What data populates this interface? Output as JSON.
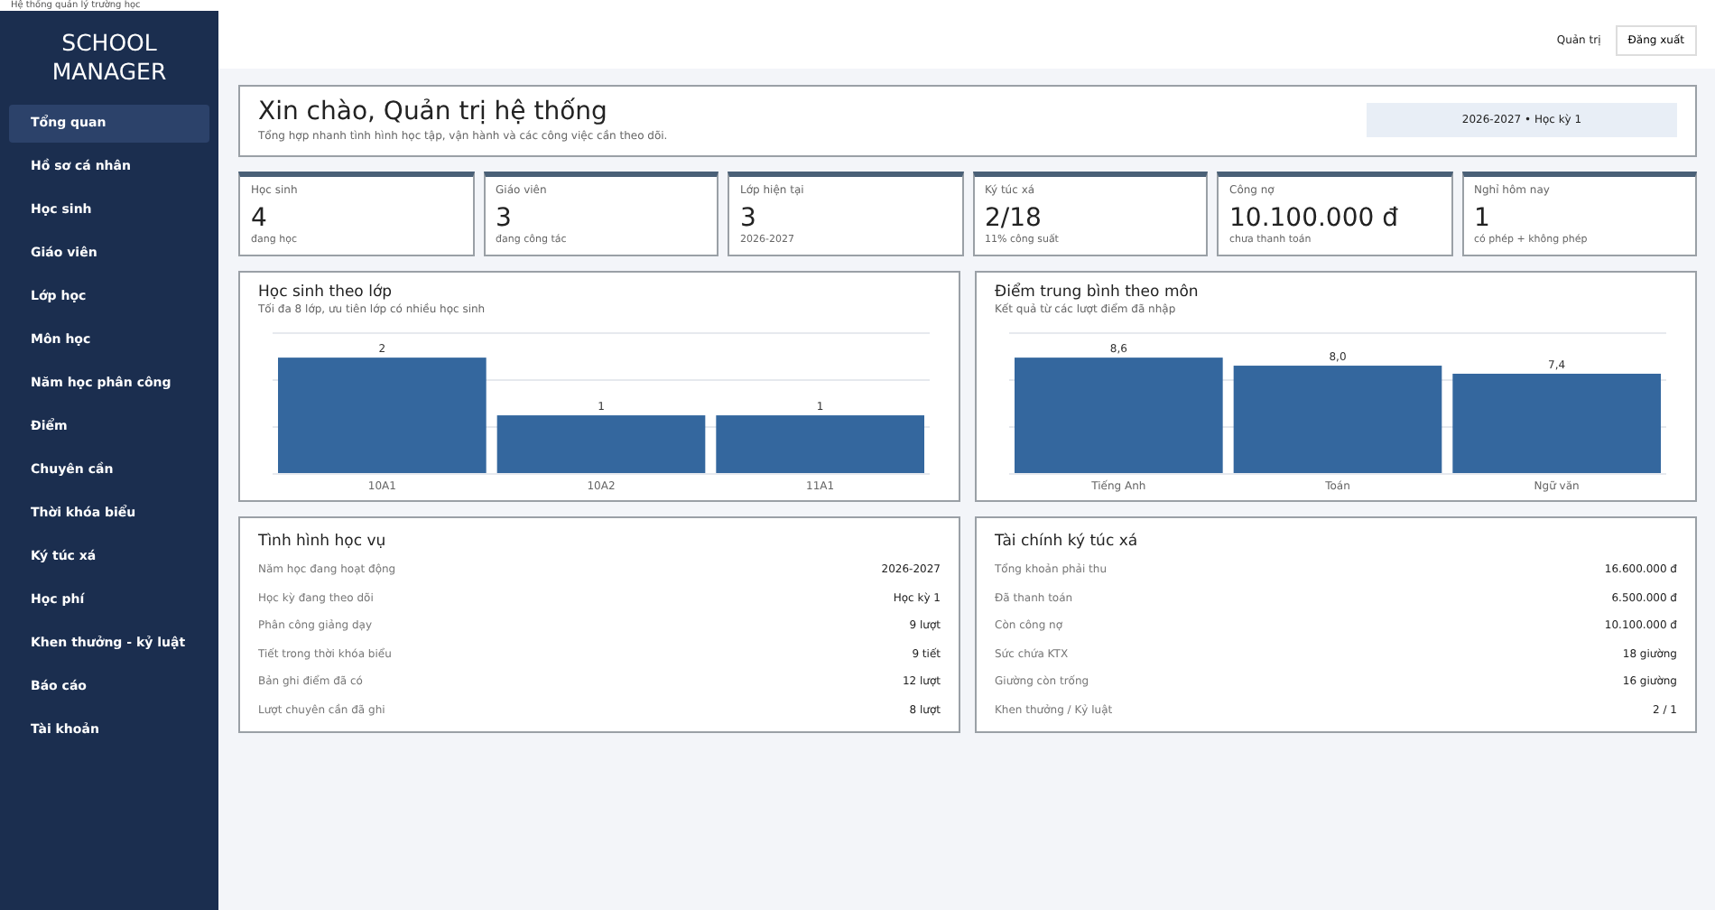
{
  "window": {
    "title": "Hệ thống quản lý trường học"
  },
  "sidebar": {
    "brand": "SCHOOL MANAGER",
    "items": [
      {
        "label": "Tổng quan",
        "selected": true
      },
      {
        "label": "Hồ sơ cá nhân",
        "selected": false
      },
      {
        "label": "Học sinh",
        "selected": false
      },
      {
        "label": "Giáo viên",
        "selected": false
      },
      {
        "label": "Lớp học",
        "selected": false
      },
      {
        "label": "Môn học",
        "selected": false
      },
      {
        "label": "Năm học  phân công",
        "selected": false
      },
      {
        "label": "Điểm",
        "selected": false
      },
      {
        "label": "Chuyên cần",
        "selected": false
      },
      {
        "label": "Thời khóa biểu",
        "selected": false
      },
      {
        "label": "Ký túc xá",
        "selected": false
      },
      {
        "label": "Học phí",
        "selected": false
      },
      {
        "label": "Khen thưởng - kỷ luật",
        "selected": false
      },
      {
        "label": "Báo cáo",
        "selected": false
      },
      {
        "label": "Tài khoản",
        "selected": false
      }
    ]
  },
  "topbar": {
    "user": "Quản trị",
    "logout_button": "Đăng xuất"
  },
  "welcome": {
    "title": "Xin chào, Quản trị hệ thống",
    "subtitle": "Tổng hợp nhanh tình hình học tập, vận hành và các công việc cần theo dõi.",
    "term_badge": "2026-2027  •  Học kỳ 1"
  },
  "stats": [
    {
      "label": "Học sinh",
      "value": "4",
      "note": "đang học"
    },
    {
      "label": "Giáo viên",
      "value": "3",
      "note": "đang công tác"
    },
    {
      "label": "Lớp hiện tại",
      "value": "3",
      "note": "2026-2027"
    },
    {
      "label": "Ký túc xá",
      "value": "2/18",
      "note": "11% công suất"
    },
    {
      "label": "Công nợ",
      "value": "10.100.000 đ",
      "note": "chưa thanh toán"
    },
    {
      "label": "Nghỉ hôm nay",
      "value": "1",
      "note": "có phép + không phép"
    }
  ],
  "charts": [
    {
      "title": "Học sinh theo lớp",
      "subtitle": "Tối đa 8 lớp, ưu tiên lớp có nhiều học sinh",
      "chart_data": {
        "type": "bar",
        "categories": [
          "10A1",
          "10A2",
          "11A1"
        ],
        "values": [
          2,
          1,
          1
        ],
        "value_labels": [
          "2",
          "1",
          "1"
        ]
      }
    },
    {
      "title": "Điểm trung bình theo môn",
      "subtitle": "Kết quả từ các lượt điểm đã nhập",
      "chart_data": {
        "type": "bar",
        "categories": [
          "Tiếng Anh",
          "Toán",
          "Ngữ văn"
        ],
        "values": [
          8.6,
          8.0,
          7.4
        ],
        "value_labels": [
          "8,6",
          "8,0",
          "7,4"
        ]
      }
    }
  ],
  "panels": [
    {
      "title": "Tình hình học vụ",
      "rows": [
        {
          "label": "Năm học đang hoạt động",
          "value": "2026-2027"
        },
        {
          "label": "Học kỳ đang theo dõi",
          "value": "Học kỳ 1"
        },
        {
          "label": "Phân công giảng dạy",
          "value": "9 lượt"
        },
        {
          "label": "Tiết trong thời khóa biểu",
          "value": "9 tiết"
        },
        {
          "label": "Bản ghi điểm đã có",
          "value": "12 lượt"
        },
        {
          "label": "Lượt chuyên cần đã ghi",
          "value": "8 lượt"
        }
      ]
    },
    {
      "title": "Tài chính  ký túc xá",
      "rows": [
        {
          "label": "Tổng khoản phải thu",
          "value": "16.600.000 đ"
        },
        {
          "label": "Đã thanh toán",
          "value": "6.500.000 đ"
        },
        {
          "label": "Còn công nợ",
          "value": "10.100.000 đ"
        },
        {
          "label": "Sức chứa KTX",
          "value": "18 giường"
        },
        {
          "label": "Giường còn trống",
          "value": "16 giường"
        },
        {
          "label": "Khen thưởng / Kỷ luật",
          "value": "2 / 1"
        }
      ]
    }
  ]
}
